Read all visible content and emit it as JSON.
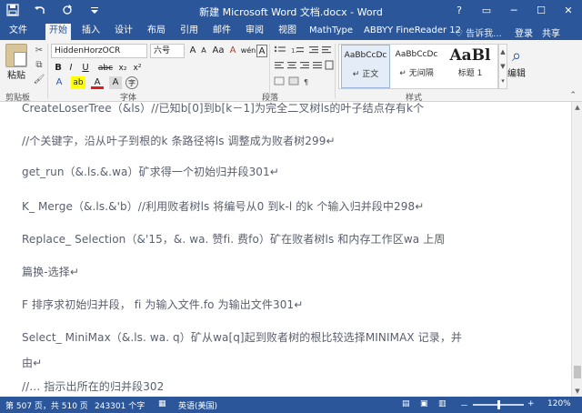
{
  "window": {
    "title": "新建 Microsoft Word 文档.docx - Word",
    "help_glyph": "?",
    "ribbon_display_glyph": "▭",
    "minimize_glyph": "─",
    "maximize_glyph": "☐",
    "close_glyph": "✕"
  },
  "qat": {
    "save_icon": "save-icon",
    "undo_icon": "undo-icon",
    "redo_icon": "redo-icon",
    "customize_icon": "qat-dropdown-icon"
  },
  "tabs": [
    "文件",
    "开始",
    "插入",
    "设计",
    "布局",
    "引用",
    "邮件",
    "审阅",
    "视图",
    "MathType",
    "ABBYY FineReader 12"
  ],
  "active_tab": "开始",
  "tell_me": "♡ 告诉我...",
  "login": "登录",
  "share": "共享",
  "ribbon": {
    "clipboard": {
      "paste": "粘贴",
      "label": "剪贴板"
    },
    "font": {
      "name": "HiddenHorzOCR",
      "size": "六号",
      "bold": "B",
      "italic": "I",
      "underline": "U",
      "strike": "abc",
      "subscript": "x₂",
      "superscript": "x²",
      "grow": "A",
      "shrink": "A",
      "case": "Aa",
      "clear": "A",
      "phonetic": "wén",
      "border_char": "A",
      "highlight": "ab",
      "font_color": "A",
      "shading": "A",
      "enclose": "字",
      "label": "字体"
    },
    "paragraph": {
      "label": "段落"
    },
    "styles": {
      "label": "样式",
      "items": [
        {
          "preview": "AaBbCcDc",
          "name": "↵ 正文"
        },
        {
          "preview": "AaBbCcDc",
          "name": "↵ 无间隔"
        },
        {
          "preview": "AaBl",
          "name": "标题 1"
        }
      ]
    },
    "editing": {
      "label": "编辑"
    }
  },
  "document": {
    "lines": [
      "CreateLoserTree（&ls）//已知b[0]到b[k－1]为完全二叉树ls的叶子结点存有k个",
      "//个关键字，沿从叶子到根的k 条路径将ls 调整成为败者树299↵",
      "get_run（&.ls.&.wa）矿求得一个初始归并段301↵",
      "K_ Merge（&.ls.&'b）//利用败者树ls 将编号从0 到k-l 的k 个输入归并段中298↵",
      "Replace_ Selection（&'15，&. wa. 赞fi. 费fo）矿在败者树ls 和内存工作区wa 上周",
      "篇换-选择↵",
      "F 排序求初始归并段，  fi 为输入文件.fo 为输出文件301↵",
      "Select_ MiniMax（&.ls. wa. q）矿从wa[q]起到败者树的根比较选择MINIMAX 记录，并",
      "由↵",
      "//… 指示出所在的归并段302"
    ]
  },
  "status": {
    "page": "第 507 页，共 510 页",
    "words": "243301 个字",
    "language": "英语(美国)",
    "zoom_minus": "－",
    "zoom_plus": "+",
    "zoom": "120%",
    "zoom_fraction": 0.5
  }
}
